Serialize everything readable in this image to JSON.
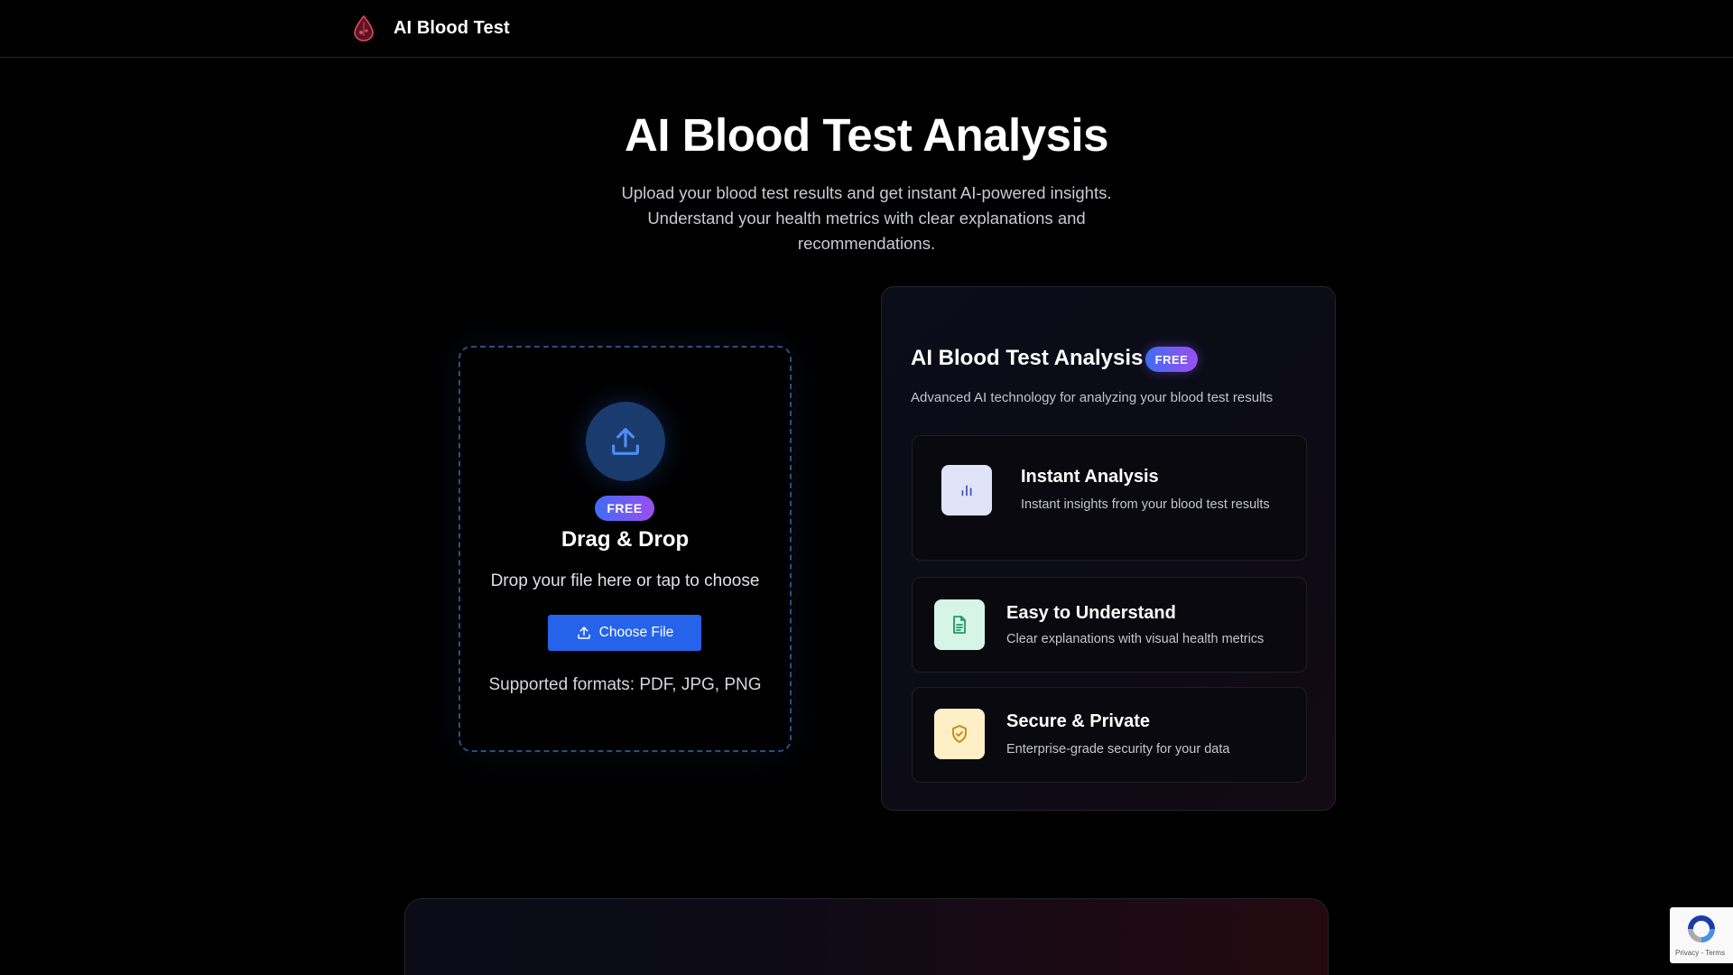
{
  "header": {
    "brand_name": "AI Blood Test",
    "logo_icon": "blood-drop-icon"
  },
  "hero": {
    "title": "AI Blood Test Analysis",
    "subtitle_lines": [
      "Upload your blood test results and get instant AI-powered insights.",
      "Understand your health metrics with clear explanations and",
      "recommendations."
    ]
  },
  "upload": {
    "icon": "upload-icon",
    "badge": "FREE",
    "title": "Drag & Drop",
    "text": "Drop your file here or tap to choose",
    "button_label": "Choose File",
    "formats": "Supported formats: PDF, JPG, PNG"
  },
  "panel": {
    "title": "AI Blood Test Analysis",
    "badge": "FREE",
    "subtitle": "Advanced AI technology for analyzing your blood test results",
    "features": [
      {
        "title": "Instant Analysis",
        "desc": "Instant insights from your blood test results",
        "icon": "bar-chart-icon",
        "icon_color": "#4a5ab8"
      },
      {
        "title": "Easy to Understand",
        "desc": "Clear explanations with visual health metrics",
        "icon": "document-icon",
        "icon_color": "#1f9a63"
      },
      {
        "title": "Secure & Private",
        "desc": "Enterprise-grade security for your data",
        "icon": "shield-check-icon",
        "icon_color": "#c8860e"
      }
    ]
  },
  "recaptcha": {
    "links": "Privacy - Terms"
  },
  "colors": {
    "accent_blue": "#2563eb",
    "badge_gradient_start": "#3f6cf2",
    "badge_gradient_end": "#9b4ff2",
    "background": "#000000"
  }
}
